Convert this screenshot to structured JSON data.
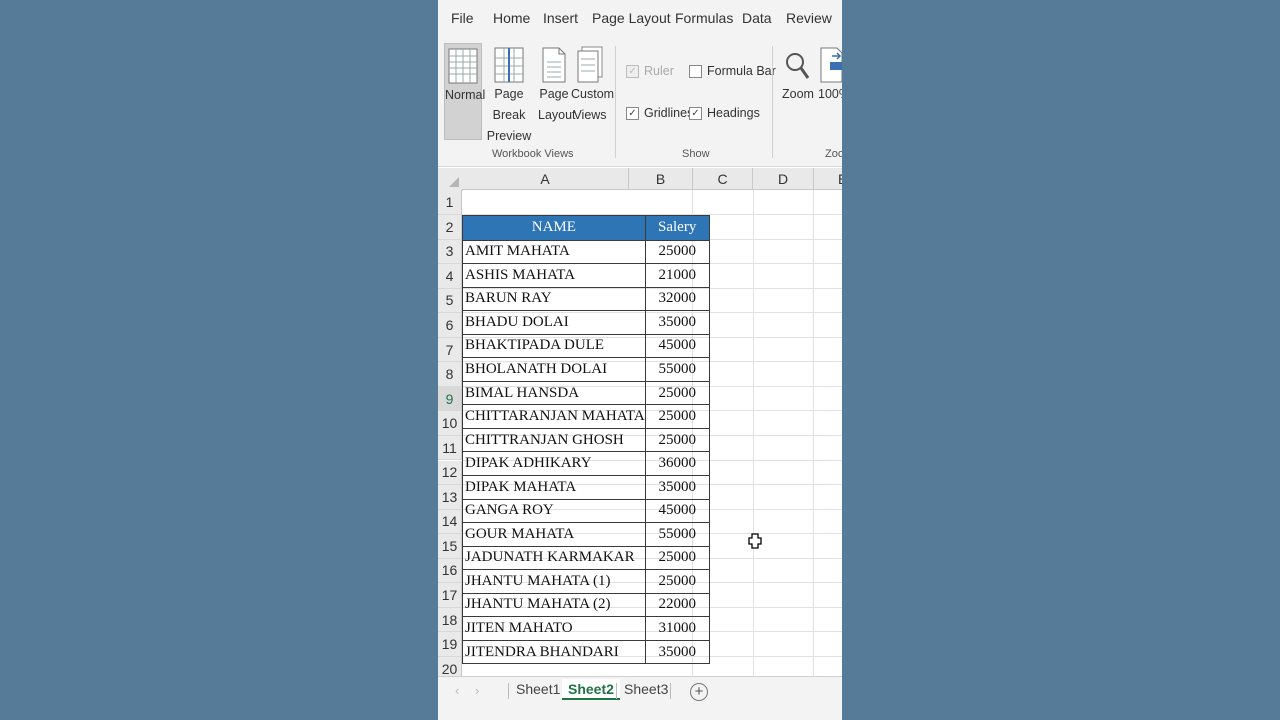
{
  "menu": {
    "tabs": [
      "File",
      "Home",
      "Insert",
      "Page Layout",
      "Formulas",
      "Data",
      "Review"
    ]
  },
  "ribbon": {
    "workbook_views": {
      "normal": "Normal",
      "page_break_1": "Page Break",
      "page_break_2": "Preview",
      "page_layout_1": "Page",
      "page_layout_2": "Layout",
      "custom_views_1": "Custom",
      "custom_views_2": "Views",
      "group_label": "Workbook Views"
    },
    "show": {
      "ruler": "Ruler",
      "formula_bar": "Formula Bar",
      "gridlines": "Gridlines",
      "headings": "Headings",
      "group_label": "Show"
    },
    "zoom": {
      "zoom_label": "Zoom",
      "hundred_label": "100%",
      "group_label": "Zoo"
    }
  },
  "sheet": {
    "columns": [
      "A",
      "B",
      "C",
      "D",
      "E"
    ],
    "rows": [
      "1",
      "2",
      "3",
      "4",
      "5",
      "6",
      "7",
      "8",
      "9",
      "10",
      "11",
      "12",
      "13",
      "14",
      "15",
      "16",
      "17",
      "18",
      "19",
      "20"
    ],
    "active_row": "9",
    "table": {
      "header_name": "NAME",
      "header_salary": "Salery",
      "records": [
        {
          "name": "AMIT MAHATA",
          "salary": "25000"
        },
        {
          "name": "ASHIS MAHATA",
          "salary": "21000"
        },
        {
          "name": "BARUN RAY",
          "salary": "32000"
        },
        {
          "name": "BHADU DOLAI",
          "salary": "35000"
        },
        {
          "name": "BHAKTIPADA DULE",
          "salary": "45000"
        },
        {
          "name": "BHOLANATH DOLAI",
          "salary": "55000"
        },
        {
          "name": "BIMAL HANSDA",
          "salary": "25000"
        },
        {
          "name": "CHITTARANJAN MAHATA",
          "salary": "25000"
        },
        {
          "name": "CHITTRANJAN GHOSH",
          "salary": "25000"
        },
        {
          "name": "DIPAK ADHIKARY",
          "salary": "36000"
        },
        {
          "name": "DIPAK MAHATA",
          "salary": "35000"
        },
        {
          "name": "GANGA ROY",
          "salary": "45000"
        },
        {
          "name": "GOUR MAHATA",
          "salary": "55000"
        },
        {
          "name": "JADUNATH KARMAKAR",
          "salary": "25000"
        },
        {
          "name": "JHANTU MAHATA (1)",
          "salary": "25000"
        },
        {
          "name": "JHANTU MAHATA (2)",
          "salary": "22000"
        },
        {
          "name": "JITEN MAHATO",
          "salary": "31000"
        },
        {
          "name": "JITENDRA BHANDARI",
          "salary": "35000"
        }
      ]
    }
  },
  "sheet_tabs": {
    "tabs": [
      "Sheet1",
      "Sheet2",
      "Sheet3"
    ],
    "active": "Sheet2",
    "add_symbol": "+"
  },
  "colors": {
    "background": "#557b99",
    "header_fill": "#2e75b6",
    "accent_green": "#217346"
  }
}
